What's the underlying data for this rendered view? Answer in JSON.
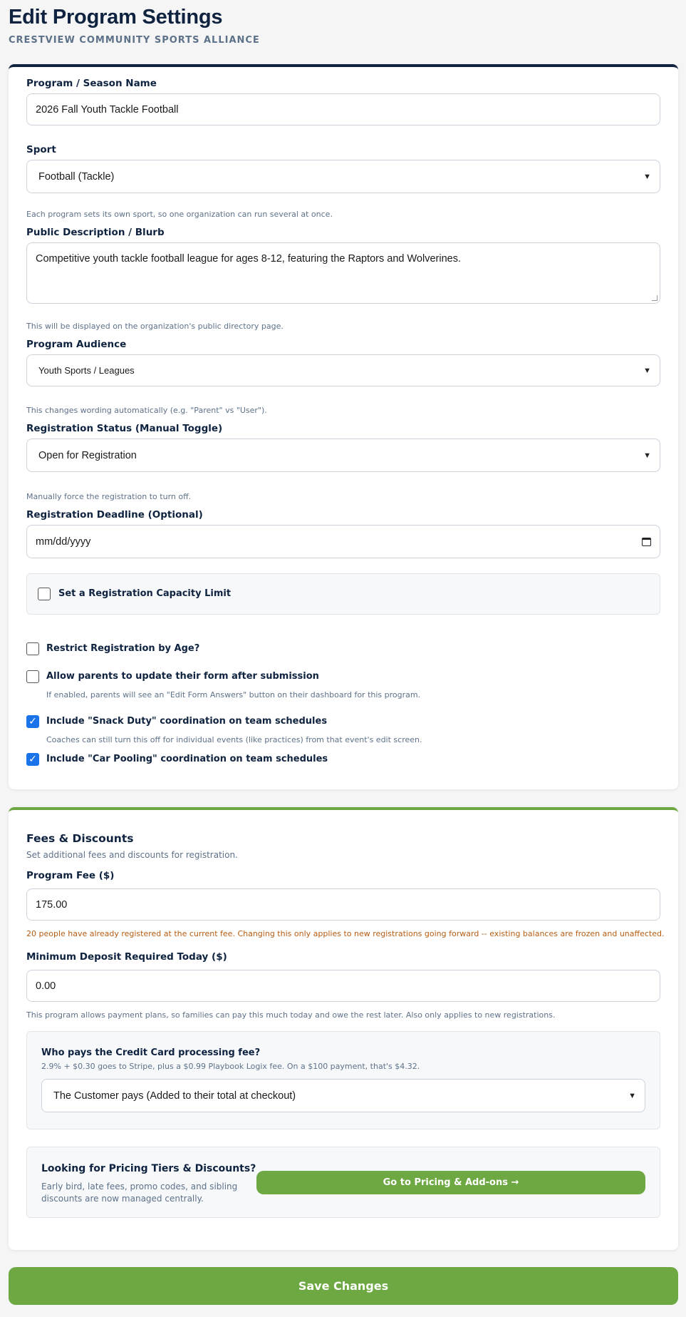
{
  "header": {
    "title": "Edit Program Settings",
    "org_name": "CRESTVIEW COMMUNITY SPORTS ALLIANCE"
  },
  "program": {
    "name_label": "Program / Season Name",
    "name_value": "2026 Fall Youth Tackle Football",
    "sport_label": "Sport",
    "sport_value": "Football (Tackle)",
    "sport_help": "Each program sets its own sport, so one organization can run several at once.",
    "description_label": "Public Description / Blurb",
    "description_value": "Competitive youth tackle football league for ages 8-12, featuring the Raptors and Wolverines.",
    "description_help": "This will be displayed on the organization's public directory page.",
    "audience_label": "Program Audience",
    "audience_value": "Youth Sports / Leagues",
    "audience_help": "This changes wording automatically (e.g. \"Parent\" vs \"User\").",
    "status_label": "Registration Status (Manual Toggle)",
    "status_value": "Open for Registration",
    "status_help": "Manually force the registration to turn off.",
    "deadline_label": "Registration Deadline (Optional)",
    "deadline_placeholder": "mm/dd/yyyy",
    "capacity_label": "Set a Registration Capacity Limit",
    "age_label": "Restrict Registration by Age?",
    "update_form_label": "Allow parents to update their form after submission",
    "update_form_help": "If enabled, parents will see an \"Edit Form Answers\" button on their dashboard for this program.",
    "snack_label": "Include \"Snack Duty\" coordination on team schedules",
    "snack_help": "Coaches can still turn this off for individual events (like practices) from that event's edit screen.",
    "carpool_label": "Include \"Car Pooling\" coordination on team schedules"
  },
  "fees": {
    "title": "Fees & Discounts",
    "subtitle": "Set additional fees and discounts for registration.",
    "fee_label": "Program Fee ($)",
    "fee_value": "175.00",
    "fee_warning": "20 people have already registered at the current fee. Changing this only applies to new registrations going forward -- existing balances are frozen and unaffected.",
    "deposit_label": "Minimum Deposit Required Today ($)",
    "deposit_value": "0.00",
    "deposit_help": "This program allows payment plans, so families can pay this much today and owe the rest later. Also only applies to new registrations.",
    "cc_title": "Who pays the Credit Card processing fee?",
    "cc_help": "2.9% + $0.30 goes to Stripe, plus a $0.99 Playbook Logix fee. On a $100 payment, that's $4.32.",
    "cc_value": "The Customer pays (Added to their total at checkout)",
    "tiers_title": "Looking for Pricing Tiers & Discounts?",
    "tiers_help_line1": "Early bird, late fees, promo codes, and sibling",
    "tiers_help_line2": "discounts are now managed centrally.",
    "tiers_button": "Go to Pricing & Add-ons →"
  },
  "save_button": "Save Changes",
  "icons": {
    "chevron": "chevron-down-icon",
    "calendar": "calendar-icon",
    "check": "check-icon"
  },
  "colors": {
    "navy": "#0f2340",
    "green": "#6ea843",
    "checkbox_blue": "#1a73e8",
    "warning": "#b65d12"
  }
}
